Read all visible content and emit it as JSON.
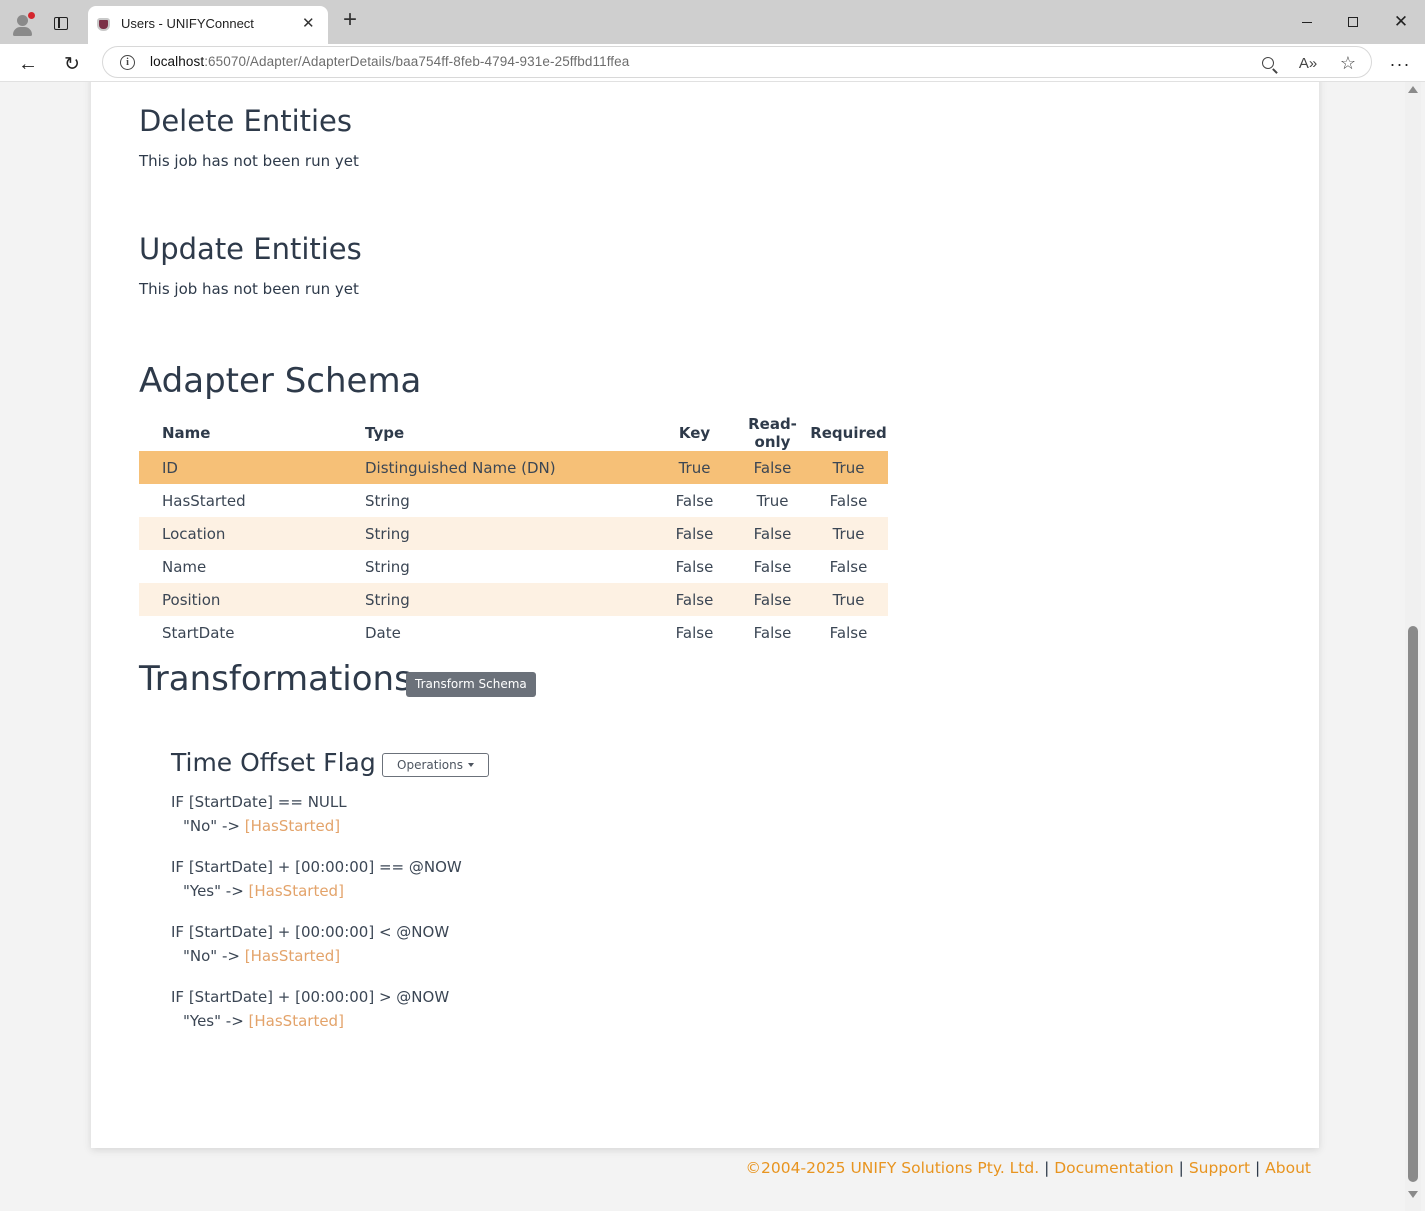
{
  "browser": {
    "tab_title": "Users - UNIFYConnect",
    "tab_close": "✕",
    "new_tab": "+",
    "url_host": "localhost",
    "url_rest": ":65070/Adapter/AdapterDetails/baa754ff-8feb-4794-931e-25ffbd11ffea",
    "back_glyph": "←",
    "reload_glyph": "↻",
    "read_aloud_glyph": "A»",
    "favorite_glyph": "☆",
    "more_glyph": "···",
    "close_glyph": "✕"
  },
  "jobs": [
    {
      "title": "Delete Entities",
      "status": "This job has not been run yet"
    },
    {
      "title": "Update Entities",
      "status": "This job has not been run yet"
    }
  ],
  "schema": {
    "title": "Adapter Schema",
    "columns": [
      "Name",
      "Type",
      "Key",
      "Read-only",
      "Required"
    ],
    "rows": [
      {
        "name": "ID",
        "type": "Distinguished Name (DN)",
        "key": "True",
        "readonly": "False",
        "required": "True"
      },
      {
        "name": "HasStarted",
        "type": "String",
        "key": "False",
        "readonly": "True",
        "required": "False"
      },
      {
        "name": "Location",
        "type": "String",
        "key": "False",
        "readonly": "False",
        "required": "True"
      },
      {
        "name": "Name",
        "type": "String",
        "key": "False",
        "readonly": "False",
        "required": "False"
      },
      {
        "name": "Position",
        "type": "String",
        "key": "False",
        "readonly": "False",
        "required": "True"
      },
      {
        "name": "StartDate",
        "type": "Date",
        "key": "False",
        "readonly": "False",
        "required": "False"
      }
    ]
  },
  "transformations": {
    "title": "Transformations",
    "button": "Transform Schema",
    "item_title": "Time Offset Flag",
    "operations_button": "Operations",
    "rules": [
      {
        "condition": "IF [StartDate] == NULL",
        "value": "\"No\" ->",
        "target": "[HasStarted]"
      },
      {
        "condition": "IF [StartDate] + [00:00:00] == @NOW",
        "value": "\"Yes\" ->",
        "target": "[HasStarted]"
      },
      {
        "condition": "IF [StartDate] + [00:00:00] < @NOW",
        "value": "\"No\" ->",
        "target": "[HasStarted]"
      },
      {
        "condition": "IF [StartDate] + [00:00:00] > @NOW",
        "value": "\"Yes\" ->",
        "target": "[HasStarted]"
      }
    ]
  },
  "footer": {
    "copyright": "©2004-2025 UNIFY Solutions Pty. Ltd.",
    "separator": " | ",
    "documentation": "Documentation",
    "support": "Support",
    "about": "About"
  },
  "colors": {
    "accent": "#e8941f",
    "highlight_row": "#f6c077",
    "stripe_row": "#fdf1e3",
    "button_grey": "#6b717a"
  }
}
